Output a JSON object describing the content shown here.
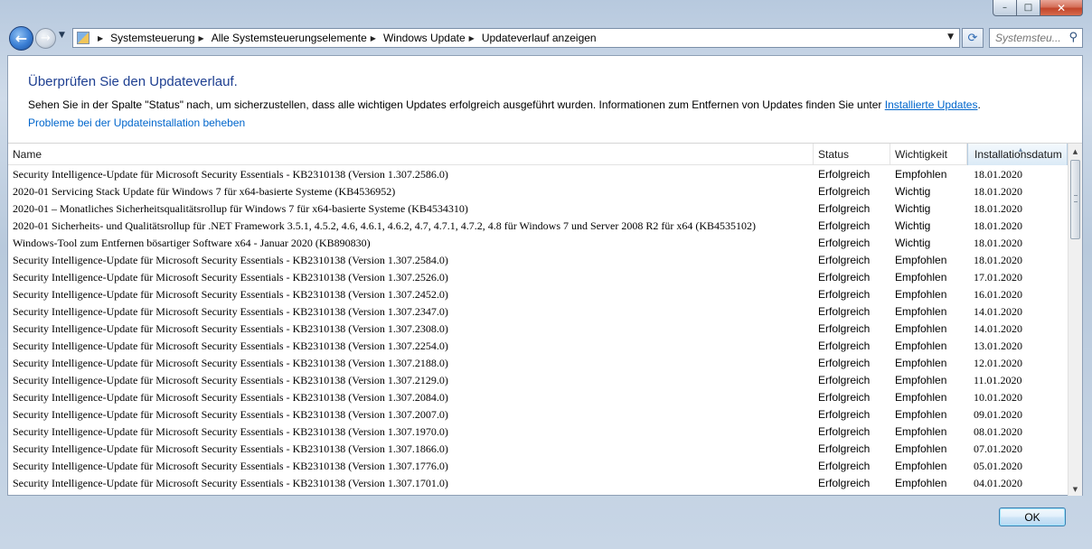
{
  "window": {
    "minimize_glyph": "–",
    "maximize_glyph": "□",
    "close_glyph": "✕"
  },
  "nav": {
    "back_glyph": "←",
    "forward_glyph": "→",
    "history_glyph": "▼",
    "breadcrumbs": [
      "Systemsteuerung",
      "Alle Systemsteuerungselemente",
      "Windows Update",
      "Updateverlauf anzeigen"
    ],
    "dropdown_glyph": "▼",
    "refresh_glyph": "⟳",
    "search_placeholder": "Systemsteu...",
    "search_glyph": "⚲"
  },
  "page": {
    "heading": "Überprüfen Sie den Updateverlauf.",
    "description": "Sehen Sie in der Spalte \"Status\" nach, um sicherzustellen, dass alle wichtigen Updates erfolgreich ausgeführt wurden. Informationen zum Entfernen von Updates finden Sie unter ",
    "description_link": "Installierte Updates",
    "description_end": ".",
    "trouble_link": "Probleme bei der Updateinstallation beheben"
  },
  "table": {
    "columns": [
      "Name",
      "Status",
      "Wichtigkeit",
      "Installationsdatum"
    ],
    "sort_glyph": "▲",
    "rows": [
      [
        "Security Intelligence-Update für Microsoft Security Essentials - KB2310138 (Version 1.307.2586.0)",
        "Erfolgreich",
        "Empfohlen",
        "18.01.2020"
      ],
      [
        "2020-01 Servicing Stack Update für Windows 7 für x64-basierte Systeme (KB4536952)",
        "Erfolgreich",
        "Wichtig",
        "18.01.2020"
      ],
      [
        "2020-01 – Monatliches Sicherheitsqualitätsrollup für Windows 7 für x64-basierte Systeme (KB4534310)",
        "Erfolgreich",
        "Wichtig",
        "18.01.2020"
      ],
      [
        "2020-01 Sicherheits- und Qualitätsrollup für .NET Framework 3.5.1, 4.5.2, 4.6, 4.6.1, 4.6.2, 4.7, 4.7.1, 4.7.2, 4.8 für Windows 7 und Server 2008 R2 für x64 (KB4535102)",
        "Erfolgreich",
        "Wichtig",
        "18.01.2020"
      ],
      [
        "Windows-Tool zum Entfernen bösartiger Software x64 - Januar 2020 (KB890830)",
        "Erfolgreich",
        "Wichtig",
        "18.01.2020"
      ],
      [
        "Security Intelligence-Update für Microsoft Security Essentials - KB2310138 (Version 1.307.2584.0)",
        "Erfolgreich",
        "Empfohlen",
        "18.01.2020"
      ],
      [
        "Security Intelligence-Update für Microsoft Security Essentials - KB2310138 (Version 1.307.2526.0)",
        "Erfolgreich",
        "Empfohlen",
        "17.01.2020"
      ],
      [
        "Security Intelligence-Update für Microsoft Security Essentials - KB2310138 (Version 1.307.2452.0)",
        "Erfolgreich",
        "Empfohlen",
        "16.01.2020"
      ],
      [
        "Security Intelligence-Update für Microsoft Security Essentials - KB2310138 (Version 1.307.2347.0)",
        "Erfolgreich",
        "Empfohlen",
        "14.01.2020"
      ],
      [
        "Security Intelligence-Update für Microsoft Security Essentials - KB2310138 (Version 1.307.2308.0)",
        "Erfolgreich",
        "Empfohlen",
        "14.01.2020"
      ],
      [
        "Security Intelligence-Update für Microsoft Security Essentials - KB2310138 (Version 1.307.2254.0)",
        "Erfolgreich",
        "Empfohlen",
        "13.01.2020"
      ],
      [
        "Security Intelligence-Update für Microsoft Security Essentials - KB2310138 (Version 1.307.2188.0)",
        "Erfolgreich",
        "Empfohlen",
        "12.01.2020"
      ],
      [
        "Security Intelligence-Update für Microsoft Security Essentials - KB2310138 (Version 1.307.2129.0)",
        "Erfolgreich",
        "Empfohlen",
        "11.01.2020"
      ],
      [
        "Security Intelligence-Update für Microsoft Security Essentials - KB2310138 (Version 1.307.2084.0)",
        "Erfolgreich",
        "Empfohlen",
        "10.01.2020"
      ],
      [
        "Security Intelligence-Update für Microsoft Security Essentials - KB2310138 (Version 1.307.2007.0)",
        "Erfolgreich",
        "Empfohlen",
        "09.01.2020"
      ],
      [
        "Security Intelligence-Update für Microsoft Security Essentials - KB2310138 (Version 1.307.1970.0)",
        "Erfolgreich",
        "Empfohlen",
        "08.01.2020"
      ],
      [
        "Security Intelligence-Update für Microsoft Security Essentials - KB2310138 (Version 1.307.1866.0)",
        "Erfolgreich",
        "Empfohlen",
        "07.01.2020"
      ],
      [
        "Security Intelligence-Update für Microsoft Security Essentials - KB2310138 (Version 1.307.1776.0)",
        "Erfolgreich",
        "Empfohlen",
        "05.01.2020"
      ],
      [
        "Security Intelligence-Update für Microsoft Security Essentials - KB2310138 (Version 1.307.1701.0)",
        "Erfolgreich",
        "Empfohlen",
        "04.01.2020"
      ]
    ]
  },
  "scrollbar": {
    "up_glyph": "▲",
    "down_glyph": "▼"
  },
  "footer": {
    "ok_label": "OK"
  }
}
